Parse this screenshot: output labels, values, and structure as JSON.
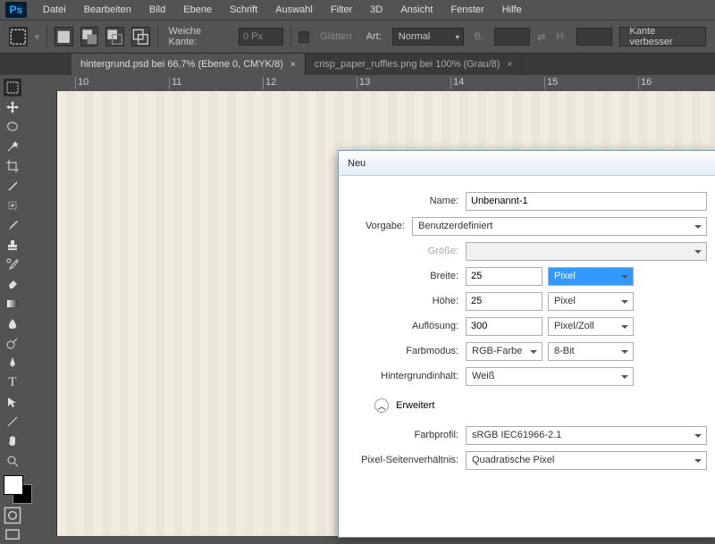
{
  "menubar": [
    "Datei",
    "Bearbeiten",
    "Bild",
    "Ebene",
    "Schrift",
    "Auswahl",
    "Filter",
    "3D",
    "Ansicht",
    "Fenster",
    "Hilfe"
  ],
  "optbar": {
    "weiche_kante": "Weiche Kante:",
    "weiche_kante_val": "0 Px",
    "glatten": "Glätten",
    "art": "Art:",
    "art_val": "Normal",
    "b": "B:",
    "h": "H:",
    "kante": "Kante verbesser"
  },
  "tabs": [
    "hintergrund.psd bei 66,7% (Ebene 0, CMYK/8)",
    "crisp_paper_ruffles.png bei 100% (Grau/8)"
  ],
  "rulerTicks": [
    "10",
    "11",
    "12",
    "13",
    "14",
    "15",
    "16"
  ],
  "dlg": {
    "title": "Neu",
    "name_lbl": "Name:",
    "name": "Unbenannt-1",
    "vorgabe_lbl": "Vorgabe:",
    "vorgabe": "Benutzerdefiniert",
    "groesse_lbl": "Größe:",
    "breite_lbl": "Breite:",
    "breite": "25",
    "breite_unit": "Pixel",
    "hoehe_lbl": "Höhe:",
    "hoehe": "25",
    "hoehe_unit": "Pixel",
    "aufl_lbl": "Auflösung:",
    "aufl": "300",
    "aufl_unit": "Pixel/Zoll",
    "farb_lbl": "Farbmodus:",
    "farb": "RGB-Farbe",
    "farb_bits": "8-Bit",
    "hinter_lbl": "Hintergrundinhalt:",
    "hinter": "Weiß",
    "erweitert": "Erweitert",
    "profil_lbl": "Farbprofil:",
    "profil": "sRGB IEC61966-2.1",
    "pixver_lbl": "Pixel-Seitenverhältnis:",
    "pixver": "Quadratische Pixel"
  }
}
